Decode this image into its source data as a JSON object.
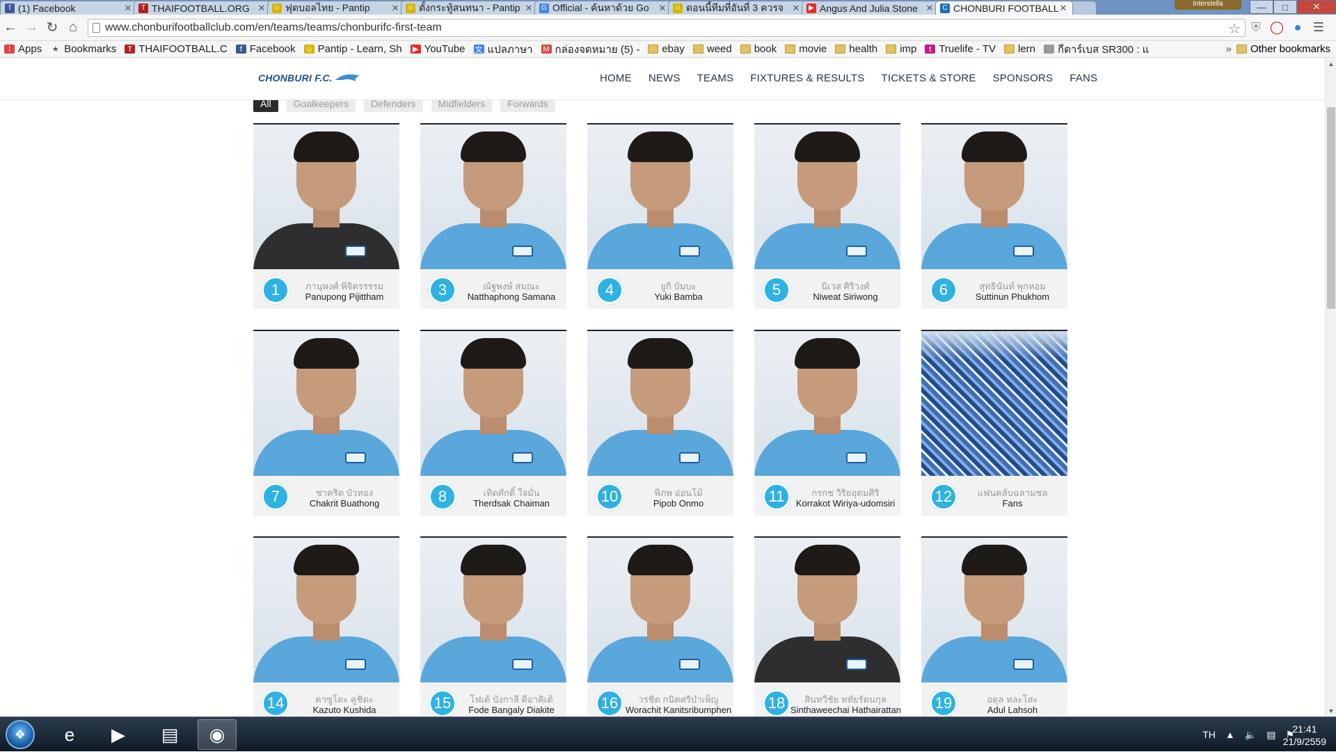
{
  "browser": {
    "tabs": [
      {
        "title": "(1) Facebook",
        "icon": "facebook-icon",
        "color": "#3b5998",
        "glyph": "f"
      },
      {
        "title": "THAIFOOTBALL.ORG",
        "icon": "thaifootball-icon",
        "color": "#b22222",
        "glyph": "T"
      },
      {
        "title": "ฟุตบอลไทย - Pantip",
        "icon": "pantip-icon",
        "color": "#d8b400",
        "glyph": "☺"
      },
      {
        "title": "ตั้งกระทู้สนทนา - Pantip",
        "icon": "pantip-icon",
        "color": "#d8b400",
        "glyph": "☺"
      },
      {
        "title": "Official - ค้นหาด้วย Go",
        "icon": "google-icon",
        "color": "#4285f4",
        "glyph": "G"
      },
      {
        "title": "ตอนนี้ทีมที่อันที่ 3 ควรจ",
        "icon": "pantip-icon",
        "color": "#d8b400",
        "glyph": "☺"
      },
      {
        "title": "Angus And Julia Stone",
        "icon": "youtube-icon",
        "color": "#e52d27",
        "glyph": "▶"
      },
      {
        "title": "CHONBURI FOOTBALL",
        "icon": "chonburi-icon",
        "color": "#1f6fb5",
        "glyph": "C",
        "active": true
      }
    ],
    "profile_label": "Interstella",
    "url": "www.chonburifootballclub.com/en/teams/teams/chonburifc-first-team",
    "bookmarks": [
      {
        "label": "Apps",
        "icon": "apps-icon"
      },
      {
        "label": "Bookmarks",
        "icon": "star-icon"
      },
      {
        "label": "THAIFOOTBALL.C",
        "icon": "thaifootball-icon"
      },
      {
        "label": "Facebook",
        "icon": "facebook-icon"
      },
      {
        "label": "Pantip - Learn, Sh",
        "icon": "pantip-icon"
      },
      {
        "label": "YouTube",
        "icon": "youtube-icon"
      },
      {
        "label": "แปลภาษา",
        "icon": "translate-icon"
      },
      {
        "label": "กล่องจดหมาย (5) -",
        "icon": "gmail-icon"
      },
      {
        "label": "ebay",
        "icon": "folder-icon"
      },
      {
        "label": "weed",
        "icon": "folder-icon"
      },
      {
        "label": "book",
        "icon": "folder-icon"
      },
      {
        "label": "movie",
        "icon": "folder-icon"
      },
      {
        "label": "health",
        "icon": "folder-icon"
      },
      {
        "label": "imp",
        "icon": "folder-icon"
      },
      {
        "label": "Truelife - TV",
        "icon": "truelife-icon"
      },
      {
        "label": "lern",
        "icon": "folder-icon"
      },
      {
        "label": "กีตาร์เบส SR300 : แ",
        "icon": "page-icon"
      }
    ],
    "other_bookmarks": "Other bookmarks"
  },
  "site": {
    "logo": "CHONBURI F.C.",
    "menu": [
      "HOME",
      "NEWS",
      "TEAMS",
      "FIXTURES & RESULTS",
      "TICKETS & STORE",
      "SPONSORS",
      "FANS"
    ],
    "filters": [
      "All",
      "Goalkeepers",
      "Defenders",
      "Midfielders",
      "Forwards"
    ],
    "active_filter": "All",
    "accent": "#2fb1e4",
    "players": [
      {
        "number": "1",
        "thai": "ภานุพงศ์ พิจิตรรรรม",
        "name": "Panupong Pijittham",
        "kit": "dark"
      },
      {
        "number": "3",
        "thai": "ณัฐพงษ์ สมณะ",
        "name": "Natthaphong Samana",
        "kit": "blue"
      },
      {
        "number": "4",
        "thai": "ยูกิ บัมบะ",
        "name": "Yuki Bamba",
        "kit": "blue"
      },
      {
        "number": "5",
        "thai": "นิเวส ศิริวงศ์",
        "name": "Niweat Siriwong",
        "kit": "blue"
      },
      {
        "number": "6",
        "thai": "สุทธินันท์ พุกหอม",
        "name": "Suttinun Phukhom",
        "kit": "blue"
      },
      {
        "number": "7",
        "thai": "ชาคริต บัวทอง",
        "name": "Chakrit Buathong",
        "kit": "blue"
      },
      {
        "number": "8",
        "thai": "เทิดศักดิ์ ใจมั่น",
        "name": "Therdsak Chaiman",
        "kit": "blue"
      },
      {
        "number": "10",
        "thai": "พิภพ อ่อนโม้",
        "name": "Pipob Onmo",
        "kit": "blue"
      },
      {
        "number": "11",
        "thai": "กรกช วิริยอุดมศิริ",
        "name": "Korrakot Wiriya-udomsiri",
        "kit": "blue"
      },
      {
        "number": "12",
        "thai": "แฟนคลับฉลามชล",
        "name": "Fans",
        "kit": "crowd"
      },
      {
        "number": "14",
        "thai": "คาซูโตะ คูชิดะ",
        "name": "Kazuto Kushida",
        "kit": "blue"
      },
      {
        "number": "15",
        "thai": "โฟเด้ บังกาลี ดีอาคิเต้",
        "name": "Fode Bangaly Diakite",
        "kit": "blue"
      },
      {
        "number": "16",
        "thai": "วรชิต กนิตศริบำเพ็ญ",
        "name": "Worachit Kanitsribumphen",
        "kit": "blue"
      },
      {
        "number": "18",
        "thai": "สินทวีชัย หทัยรัตนกุล",
        "name": "Sinthaweechai Hathairattanakool",
        "kit": "dark"
      },
      {
        "number": "19",
        "thai": "อดุล หละโสะ",
        "name": "Adul Lahsoh",
        "kit": "blue"
      }
    ]
  },
  "taskbar": {
    "apps": [
      {
        "name": "ie-icon",
        "glyph": "e"
      },
      {
        "name": "media-player-icon",
        "glyph": "▶"
      },
      {
        "name": "file-explorer-icon",
        "glyph": "▤"
      },
      {
        "name": "chrome-icon",
        "glyph": "◉",
        "active": true
      }
    ],
    "language": "TH",
    "time": "21:41",
    "date": "21/9/2559"
  }
}
